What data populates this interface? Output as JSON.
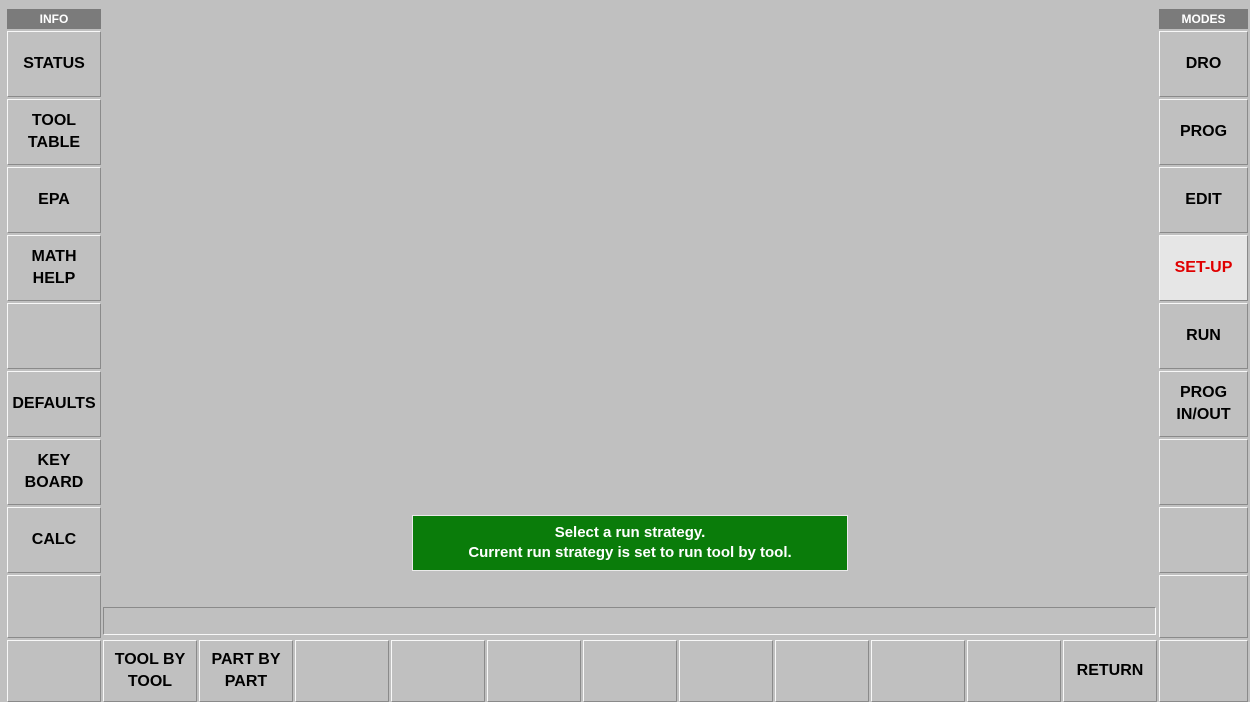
{
  "info_header": "INFO",
  "modes_header": "MODES",
  "left_buttons": [
    {
      "label": "STATUS"
    },
    {
      "label": "TOOL\nTABLE"
    },
    {
      "label": "EPA"
    },
    {
      "label": "MATH\nHELP"
    },
    {
      "label": ""
    },
    {
      "label": "DEFAULTS"
    },
    {
      "label": "KEY\nBOARD"
    },
    {
      "label": "CALC"
    },
    {
      "label": ""
    }
  ],
  "right_buttons": [
    {
      "label": "DRO"
    },
    {
      "label": "PROG"
    },
    {
      "label": "EDIT"
    },
    {
      "label": "SET-UP",
      "active": true
    },
    {
      "label": "RUN"
    },
    {
      "label": "PROG\nIN/OUT"
    },
    {
      "label": ""
    },
    {
      "label": ""
    },
    {
      "label": ""
    }
  ],
  "bottom_buttons": [
    {
      "label": ""
    },
    {
      "label": "TOOL BY\nTOOL"
    },
    {
      "label": "PART BY\nPART"
    },
    {
      "label": ""
    },
    {
      "label": ""
    },
    {
      "label": ""
    },
    {
      "label": ""
    },
    {
      "label": ""
    },
    {
      "label": ""
    },
    {
      "label": ""
    },
    {
      "label": ""
    },
    {
      "label": "RETURN"
    },
    {
      "label": ""
    }
  ],
  "message": {
    "line1": "Select a run strategy.",
    "line2": "Current run strategy is set to run tool by tool."
  },
  "colors": {
    "background": "#c0c0c0",
    "header": "#7b7b7b",
    "message_bg": "#0a7c0a",
    "active_text": "#e00000"
  }
}
